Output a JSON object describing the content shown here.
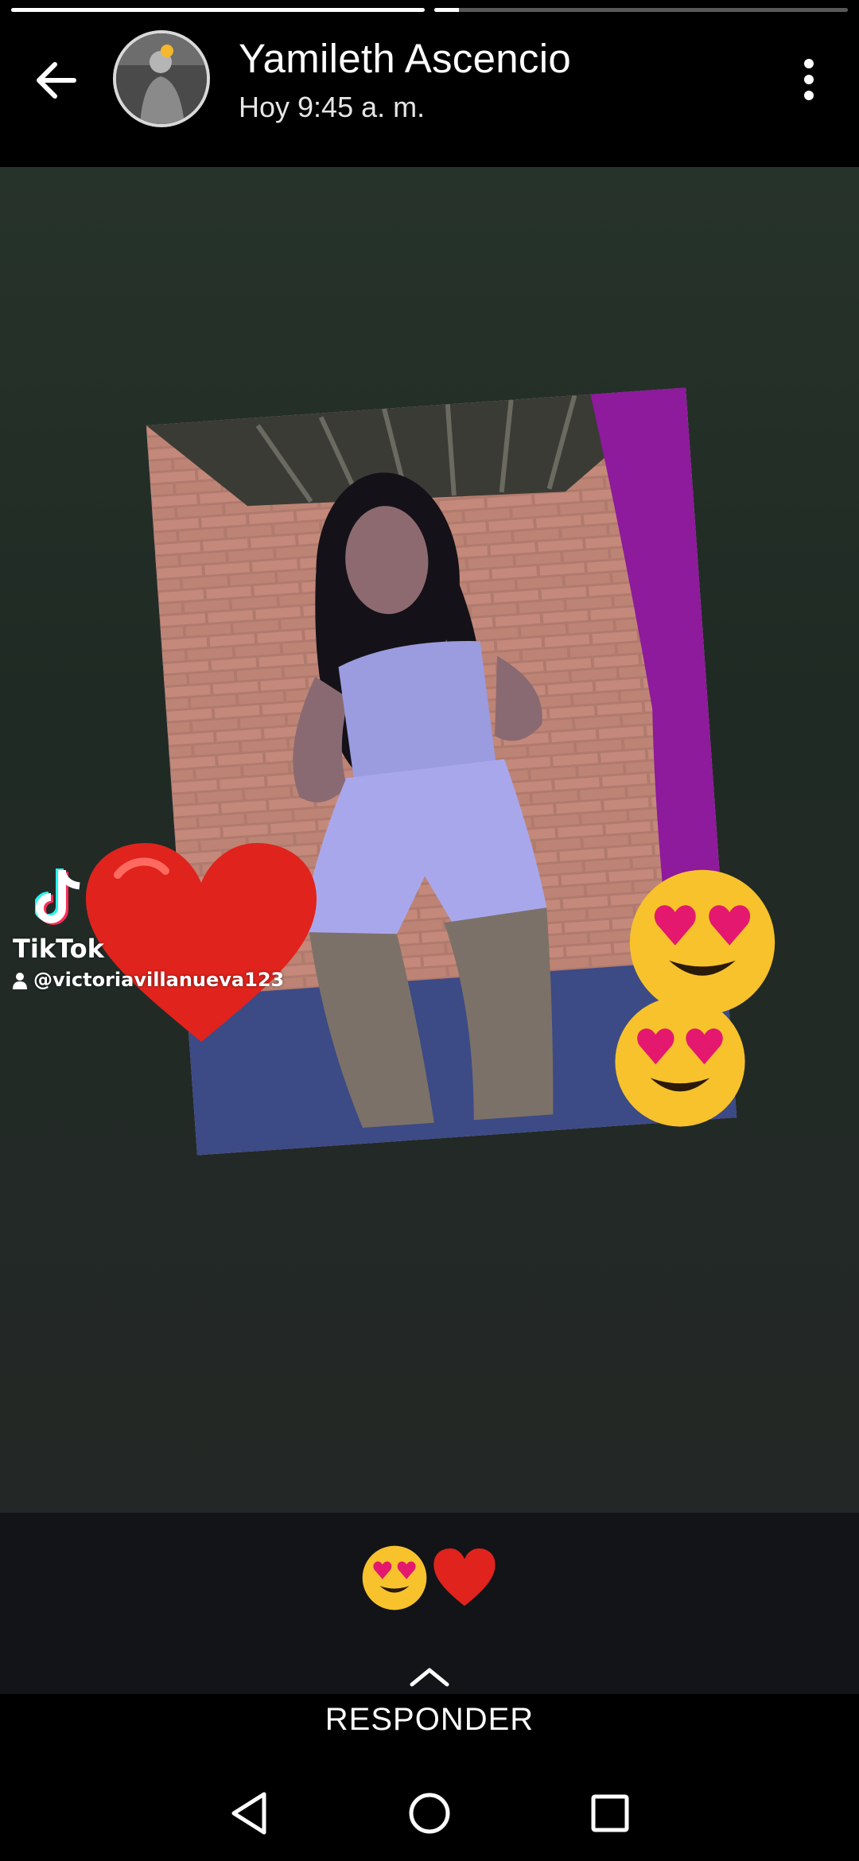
{
  "story": {
    "segments": [
      {
        "progress": 1.0
      },
      {
        "progress": 0.06
      }
    ],
    "author_name": "Yamileth Ascencio",
    "timestamp": "Hoy 9:45 a. m.",
    "back_icon": "arrow-left-icon",
    "menu_icon": "more-vertical-icon"
  },
  "content": {
    "watermark": {
      "brand": "TikTok",
      "username": "@victoriavillanueva123"
    },
    "stickers": [
      "red-heart",
      "heart-eyes-emoji",
      "heart-eyes-emoji"
    ]
  },
  "reply": {
    "quick_reactions": [
      "😍",
      "❤️"
    ],
    "label": "RESPONDER"
  },
  "navigation": {
    "back": "triangle-back-icon",
    "home": "circle-home-icon",
    "recents": "square-recents-icon"
  },
  "colors": {
    "background": "#000000",
    "content_bg": "#222a26",
    "heart_red": "#e0231d",
    "emoji_yellow": "#f7c22c"
  }
}
